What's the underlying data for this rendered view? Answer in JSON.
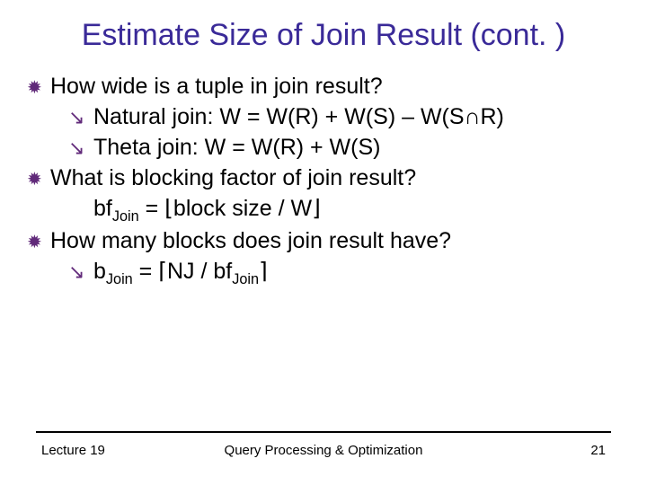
{
  "title": "Estimate Size of Join Result (cont. )",
  "bullets": {
    "b1": "How wide is a tuple in join result?",
    "b1a": "Natural join: W = W(R) + W(S) – W(S∩R)",
    "b1b": "Theta join: W = W(R) + W(S)",
    "b2": "What is blocking factor of join result?",
    "b2a_pre": "bf",
    "b2a_sub": "Join",
    "b2a_post": " = ⌊block size / W⌋",
    "b3": "How many blocks does join result have?",
    "b3a_pre": "b",
    "b3a_sub1": "Join",
    "b3a_mid": " = ⌈NJ / bf",
    "b3a_sub2": "Join",
    "b3a_post": "⌉"
  },
  "icons": {
    "burst": "✹",
    "arrow": "↘"
  },
  "footer": {
    "left": "Lecture 19",
    "center": "Query Processing & Optimization",
    "right": "21"
  }
}
